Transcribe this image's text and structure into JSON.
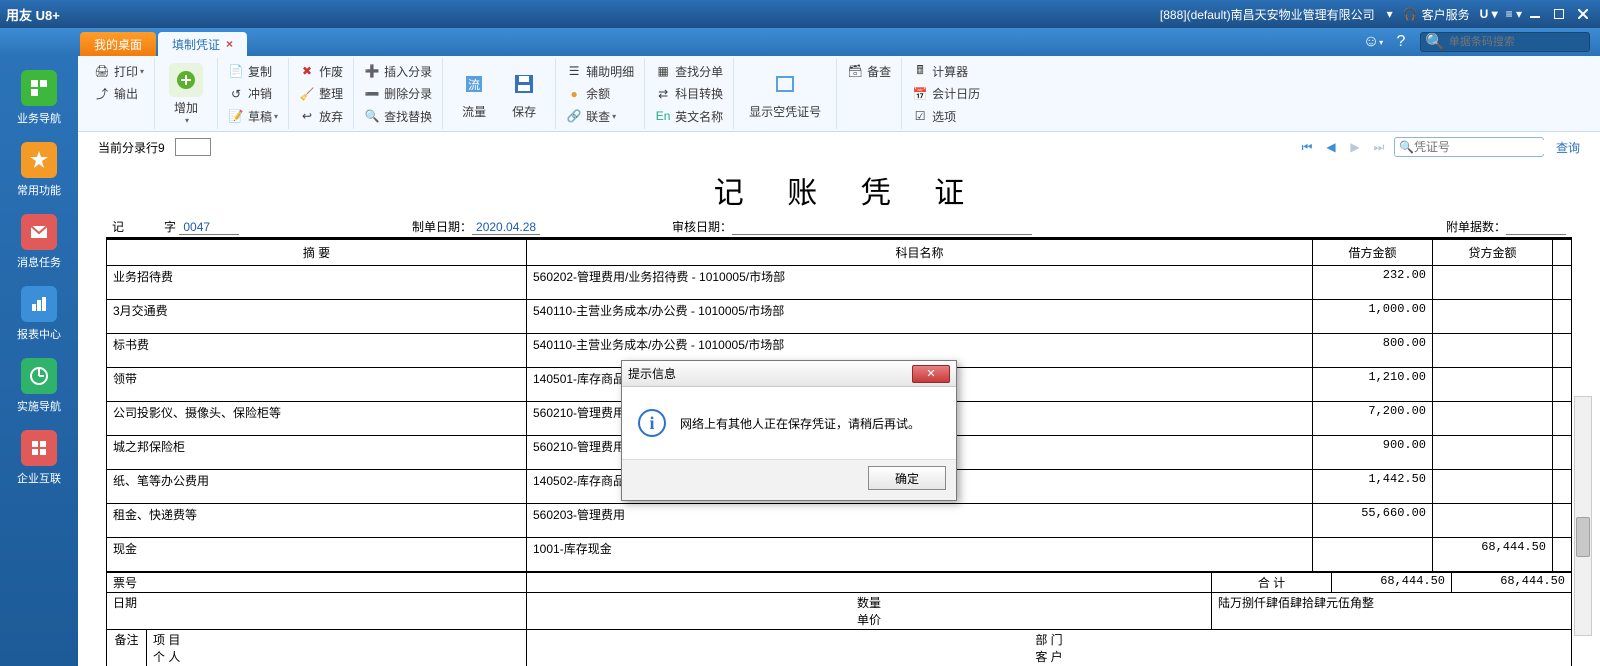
{
  "title_bar": {
    "app": "用友 U8+",
    "account": "[888](default)南昌天安物业管理有限公司",
    "service": "客户服务"
  },
  "tabs": {
    "home": "我的桌面",
    "active": "填制凭证"
  },
  "search": {
    "placeholder": "单据条码搜索"
  },
  "sidebar": [
    {
      "label": "业务导航",
      "color": "#3db83d"
    },
    {
      "label": "常用功能",
      "color": "#f39a27"
    },
    {
      "label": "消息任务",
      "color": "#e05a5a"
    },
    {
      "label": "报表中心",
      "color": "#3a8fd8"
    },
    {
      "label": "实施导航",
      "color": "#2fb36a"
    },
    {
      "label": "企业互联",
      "color": "#e05a5a"
    }
  ],
  "ribbon": {
    "g1": [
      "打印",
      "输出"
    ],
    "add": "增加",
    "g2": [
      "复制",
      "冲销",
      "草稿"
    ],
    "g3": [
      "作废",
      "整理",
      "放弃"
    ],
    "g4": [
      "插入分录",
      "删除分录",
      "查找替换"
    ],
    "flow": "流量",
    "save": "保存",
    "g5a": [
      "辅助明细",
      "余额",
      "联查"
    ],
    "g5b": [
      "查找分单",
      "科目转换",
      "英文名称"
    ],
    "showempty": "显示空凭证号",
    "g6": [
      "计算器",
      "会计日历",
      "选项"
    ],
    "backup": "备查"
  },
  "subbar": {
    "current_line": "当前分录行9",
    "voucher_num_ph": "凭证号",
    "query": "查询"
  },
  "voucher": {
    "title": "记 账 凭 证",
    "prefix": "记",
    "zi": "字",
    "number": "0047",
    "date_label": "制单日期：",
    "date": "2020.04.28",
    "audit_label": "审核日期：",
    "audit": "",
    "attach_label": "附单据数：",
    "headers": {
      "summary": "摘 要",
      "account": "科目名称",
      "debit": "借方金额",
      "credit": "贷方金额"
    },
    "rows": [
      {
        "s": "业务招待费",
        "a": "560202-管理费用/业务招待费 - 1010005/市场部",
        "d": "232.00",
        "c": ""
      },
      {
        "s": "3月交通费",
        "a": "540110-主营业务成本/办公费 - 1010005/市场部",
        "d": "1,000.00",
        "c": ""
      },
      {
        "s": "标书费",
        "a": "540110-主营业务成本/办公费 - 1010005/市场部",
        "d": "800.00",
        "c": ""
      },
      {
        "s": "领带",
        "a": "140501-库存商品",
        "d": "1,210.00",
        "c": ""
      },
      {
        "s": "公司投影仪、摄像头、保险柜等",
        "a": "560210-管理费用",
        "d": "7,200.00",
        "c": ""
      },
      {
        "s": "城之邦保险柜",
        "a": "560210-管理费用",
        "d": "900.00",
        "c": ""
      },
      {
        "s": "纸、笔等办公费用",
        "a": "140502-库存商品",
        "d": "1,442.50",
        "c": ""
      },
      {
        "s": "租金、快递费等",
        "a": "560203-管理费用",
        "d": "55,660.00",
        "c": ""
      },
      {
        "s": "现金",
        "a": "1001-库存现金",
        "d": "",
        "c": "68,444.50"
      }
    ],
    "total_label": "合 计",
    "total_debit": "68,444.50",
    "total_credit": "68,444.50",
    "upper": "陆万捌仟肆佰肆拾肆元伍角整",
    "extra": {
      "ticket": "票号",
      "date": "日期",
      "qty": "数量",
      "price": "单价",
      "remark": "备注",
      "project": "项 目",
      "person": "个 人",
      "dept": "部 门",
      "cust": "客 户"
    }
  },
  "modal": {
    "title": "提示信息",
    "msg": "网络上有其他人正在保存凭证，请稍后再试。",
    "ok": "确定"
  }
}
